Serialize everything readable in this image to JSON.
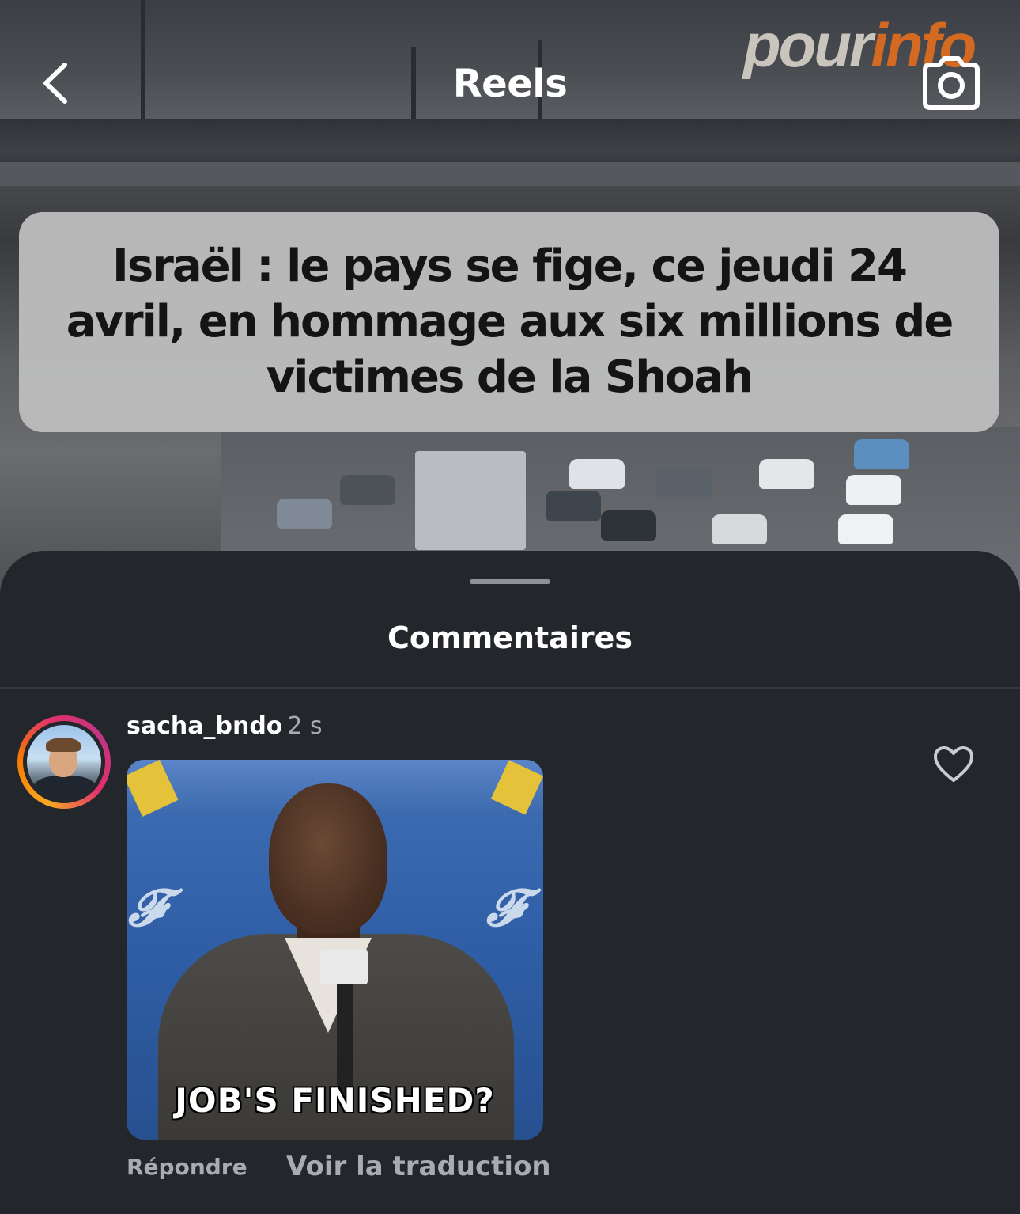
{
  "header": {
    "title": "Reels",
    "back_icon": "chevron-left-icon",
    "camera_icon": "camera-icon"
  },
  "video": {
    "watermark_part1": "pour",
    "watermark_part2": "info",
    "watermark_color": "#d46a22",
    "caption": "Israël : le pays se fige, ce jeudi 24 avril, en hommage aux six millions de victimes de la Shoah"
  },
  "comments_sheet": {
    "title": "Commentaires",
    "background": "#23262b",
    "comments": [
      {
        "username": "sacha_bndo",
        "time": "2 s",
        "gif_caption": "JOB'S FINISHED?",
        "reply_label": "Répondre",
        "translate_label": "Voir la traduction",
        "like_icon": "heart-outline-icon"
      }
    ]
  }
}
